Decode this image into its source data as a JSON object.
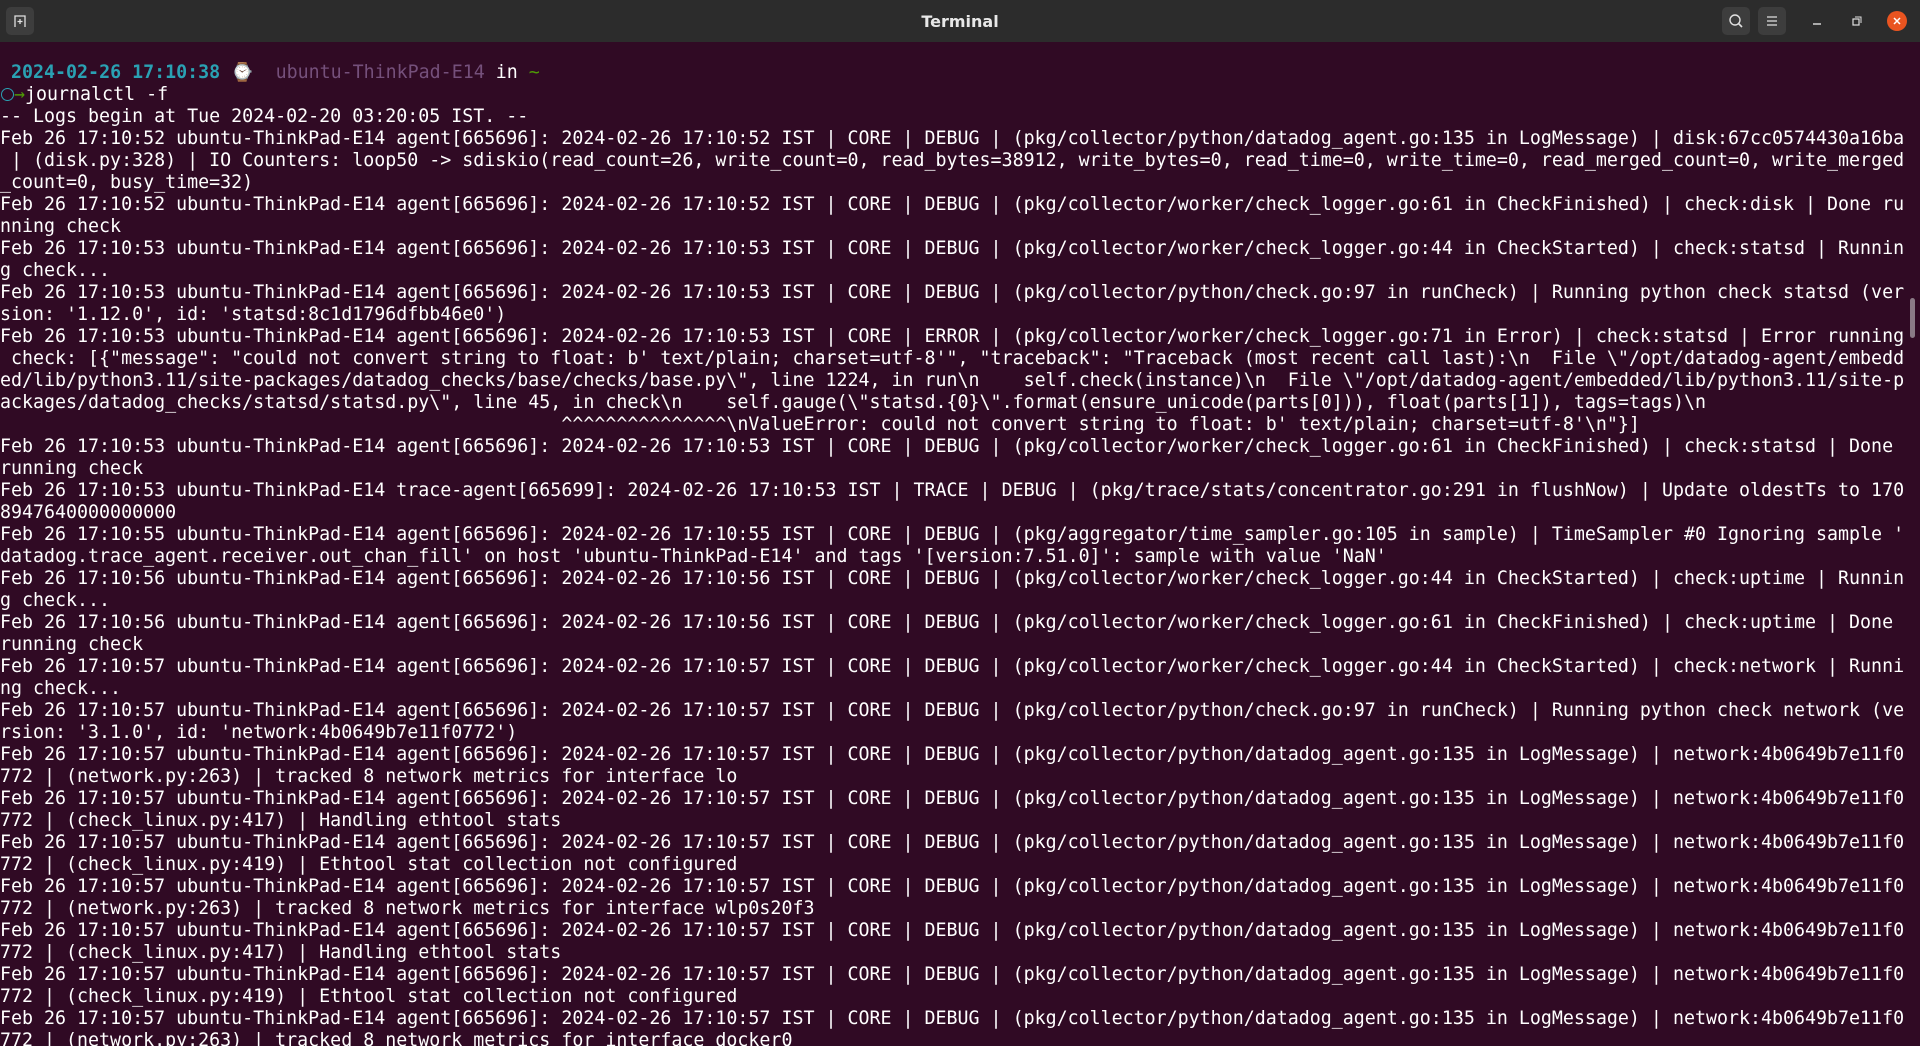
{
  "window": {
    "title": "Terminal",
    "icons": {
      "new_tab": "new-tab-icon",
      "search": "search-icon",
      "menu": "hamburger-menu-icon",
      "minimize": "minimize-icon",
      "maximize": "maximize-icon",
      "close": "close-icon"
    },
    "accent_color": "#e95420",
    "background_color": "#300a24"
  },
  "prompt": {
    "timestamp": "2024-02-26 17:10:38",
    "watch_icon": "⌚",
    "host": "ubuntu-ThinkPad-E14",
    "in_word": "in",
    "cwd": "~",
    "arrow": "→",
    "command": "journalctl -f"
  },
  "output_lines": [
    "-- Logs begin at Tue 2024-02-20 03:20:05 IST. --",
    "Feb 26 17:10:52 ubuntu-ThinkPad-E14 agent[665696]: 2024-02-26 17:10:52 IST | CORE | DEBUG | (pkg/collector/python/datadog_agent.go:135 in LogMessage) | disk:67cc0574430a16ba",
    " | (disk.py:328) | IO Counters: loop50 -> sdiskio(read_count=26, write_count=0, read_bytes=38912, write_bytes=0, read_time=0, write_time=0, read_merged_count=0, write_merged",
    "_count=0, busy_time=32)",
    "Feb 26 17:10:52 ubuntu-ThinkPad-E14 agent[665696]: 2024-02-26 17:10:52 IST | CORE | DEBUG | (pkg/collector/worker/check_logger.go:61 in CheckFinished) | check:disk | Done ru",
    "nning check",
    "Feb 26 17:10:53 ubuntu-ThinkPad-E14 agent[665696]: 2024-02-26 17:10:53 IST | CORE | DEBUG | (pkg/collector/worker/check_logger.go:44 in CheckStarted) | check:statsd | Runnin",
    "g check...",
    "Feb 26 17:10:53 ubuntu-ThinkPad-E14 agent[665696]: 2024-02-26 17:10:53 IST | CORE | DEBUG | (pkg/collector/python/check.go:97 in runCheck) | Running python check statsd (ver",
    "sion: '1.12.0', id: 'statsd:8c1d1796dfbb46e0')",
    "Feb 26 17:10:53 ubuntu-ThinkPad-E14 agent[665696]: 2024-02-26 17:10:53 IST | CORE | ERROR | (pkg/collector/worker/check_logger.go:71 in Error) | check:statsd | Error running",
    " check: [{\"message\": \"could not convert string to float: b' text/plain; charset=utf-8'\", \"traceback\": \"Traceback (most recent call last):\\n  File \\\"/opt/datadog-agent/embedd",
    "ed/lib/python3.11/site-packages/datadog_checks/base/checks/base.py\\\", line 1224, in run\\n    self.check(instance)\\n  File \\\"/opt/datadog-agent/embedded/lib/python3.11/site-p",
    "ackages/datadog_checks/statsd/statsd.py\\\", line 45, in check\\n    self.gauge(\\\"statsd.{0}\\\".format(ensure_unicode(parts[0])), float(parts[1]), tags=tags)\\n",
    "                                                   ^^^^^^^^^^^^^^^\\nValueError: could not convert string to float: b' text/plain; charset=utf-8'\\n\"}]",
    "Feb 26 17:10:53 ubuntu-ThinkPad-E14 agent[665696]: 2024-02-26 17:10:53 IST | CORE | DEBUG | (pkg/collector/worker/check_logger.go:61 in CheckFinished) | check:statsd | Done ",
    "running check",
    "Feb 26 17:10:53 ubuntu-ThinkPad-E14 trace-agent[665699]: 2024-02-26 17:10:53 IST | TRACE | DEBUG | (pkg/trace/stats/concentrator.go:291 in flushNow) | Update oldestTs to 170",
    "8947640000000000",
    "Feb 26 17:10:55 ubuntu-ThinkPad-E14 agent[665696]: 2024-02-26 17:10:55 IST | CORE | DEBUG | (pkg/aggregator/time_sampler.go:105 in sample) | TimeSampler #0 Ignoring sample '",
    "datadog.trace_agent.receiver.out_chan_fill' on host 'ubuntu-ThinkPad-E14' and tags '[version:7.51.0]': sample with value 'NaN'",
    "Feb 26 17:10:56 ubuntu-ThinkPad-E14 agent[665696]: 2024-02-26 17:10:56 IST | CORE | DEBUG | (pkg/collector/worker/check_logger.go:44 in CheckStarted) | check:uptime | Runnin",
    "g check...",
    "Feb 26 17:10:56 ubuntu-ThinkPad-E14 agent[665696]: 2024-02-26 17:10:56 IST | CORE | DEBUG | (pkg/collector/worker/check_logger.go:61 in CheckFinished) | check:uptime | Done ",
    "running check",
    "Feb 26 17:10:57 ubuntu-ThinkPad-E14 agent[665696]: 2024-02-26 17:10:57 IST | CORE | DEBUG | (pkg/collector/worker/check_logger.go:44 in CheckStarted) | check:network | Runni",
    "ng check...",
    "Feb 26 17:10:57 ubuntu-ThinkPad-E14 agent[665696]: 2024-02-26 17:10:57 IST | CORE | DEBUG | (pkg/collector/python/check.go:97 in runCheck) | Running python check network (ve",
    "rsion: '3.1.0', id: 'network:4b0649b7e11f0772')",
    "Feb 26 17:10:57 ubuntu-ThinkPad-E14 agent[665696]: 2024-02-26 17:10:57 IST | CORE | DEBUG | (pkg/collector/python/datadog_agent.go:135 in LogMessage) | network:4b0649b7e11f0",
    "772 | (network.py:263) | tracked 8 network metrics for interface lo",
    "Feb 26 17:10:57 ubuntu-ThinkPad-E14 agent[665696]: 2024-02-26 17:10:57 IST | CORE | DEBUG | (pkg/collector/python/datadog_agent.go:135 in LogMessage) | network:4b0649b7e11f0",
    "772 | (check_linux.py:417) | Handling ethtool stats",
    "Feb 26 17:10:57 ubuntu-ThinkPad-E14 agent[665696]: 2024-02-26 17:10:57 IST | CORE | DEBUG | (pkg/collector/python/datadog_agent.go:135 in LogMessage) | network:4b0649b7e11f0",
    "772 | (check_linux.py:419) | Ethtool stat collection not configured",
    "Feb 26 17:10:57 ubuntu-ThinkPad-E14 agent[665696]: 2024-02-26 17:10:57 IST | CORE | DEBUG | (pkg/collector/python/datadog_agent.go:135 in LogMessage) | network:4b0649b7e11f0",
    "772 | (network.py:263) | tracked 8 network metrics for interface wlp0s20f3",
    "Feb 26 17:10:57 ubuntu-ThinkPad-E14 agent[665696]: 2024-02-26 17:10:57 IST | CORE | DEBUG | (pkg/collector/python/datadog_agent.go:135 in LogMessage) | network:4b0649b7e11f0",
    "772 | (check_linux.py:417) | Handling ethtool stats",
    "Feb 26 17:10:57 ubuntu-ThinkPad-E14 agent[665696]: 2024-02-26 17:10:57 IST | CORE | DEBUG | (pkg/collector/python/datadog_agent.go:135 in LogMessage) | network:4b0649b7e11f0",
    "772 | (check_linux.py:419) | Ethtool stat collection not configured",
    "Feb 26 17:10:57 ubuntu-ThinkPad-E14 agent[665696]: 2024-02-26 17:10:57 IST | CORE | DEBUG | (pkg/collector/python/datadog_agent.go:135 in LogMessage) | network:4b0649b7e11f0",
    "772 | (network.py:263) | tracked 8 network metrics for interface docker0"
  ]
}
